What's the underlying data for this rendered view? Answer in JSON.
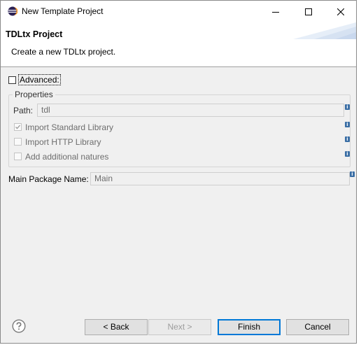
{
  "window": {
    "title": "New Template Project",
    "minimize_icon": "minimize-icon",
    "maximize_icon": "maximize-icon",
    "close_icon": "close-icon"
  },
  "header": {
    "title": "TDLtx Project",
    "description": "Create a new TDLtx project."
  },
  "advanced": {
    "label": "Advanced:",
    "checked": false
  },
  "properties": {
    "group_title": "Properties",
    "path_label": "Path:",
    "path_value": "tdl",
    "import_standard_library": {
      "label": "Import Standard Library",
      "checked": true
    },
    "import_http_library": {
      "label": "Import HTTP Library",
      "checked": false
    },
    "add_additional_natures": {
      "label": "Add additional natures",
      "checked": false
    }
  },
  "main_package": {
    "label": "Main Package Name:",
    "value": "Main"
  },
  "buttons": {
    "back": "< Back",
    "next": "Next >",
    "finish": "Finish",
    "cancel": "Cancel"
  },
  "colors": {
    "accent": "#0078d7",
    "info_icon": "#3a6ea5",
    "header_stripe": "#dbe6f4"
  }
}
